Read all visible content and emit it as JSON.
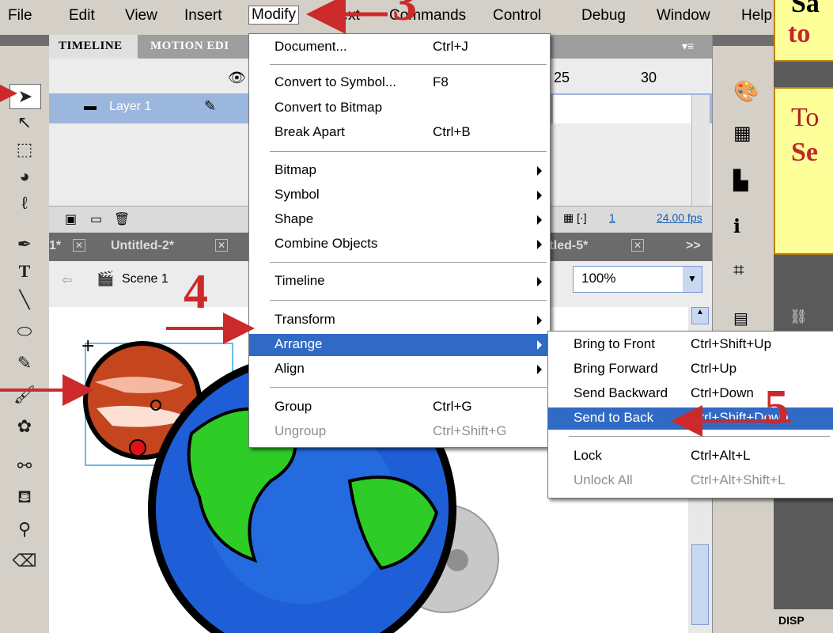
{
  "menubar": {
    "items": [
      "File",
      "Edit",
      "View",
      "Insert",
      "Modify",
      "Text",
      "Commands",
      "Control",
      "Debug",
      "Window",
      "Help"
    ]
  },
  "timeline": {
    "tab_timeline": "TIMELINE",
    "tab_motion": "MOTION EDI",
    "layer_name": "Layer 1",
    "frame_ticks": [
      "25",
      "30"
    ],
    "current_frame": "1",
    "fps": "24.00 fps"
  },
  "doctabs": {
    "tab1": "1* ",
    "tab2": "Untitled-2*",
    "tab5": "itled-5*",
    "more": ">>"
  },
  "scene": {
    "label": "Scene 1",
    "zoom": "100%"
  },
  "modify_menu": {
    "items": [
      {
        "label": "Document...",
        "shortcut": "Ctrl+J",
        "submenu": false,
        "disabled": false
      },
      {
        "label": "Convert to Symbol...",
        "shortcut": "F8",
        "submenu": false,
        "disabled": false
      },
      {
        "label": "Convert to Bitmap",
        "shortcut": "",
        "submenu": false,
        "disabled": false
      },
      {
        "label": "Break Apart",
        "shortcut": "Ctrl+B",
        "submenu": false,
        "disabled": false
      },
      {
        "label": "Bitmap",
        "shortcut": "",
        "submenu": true,
        "disabled": false
      },
      {
        "label": "Symbol",
        "shortcut": "",
        "submenu": true,
        "disabled": false
      },
      {
        "label": "Shape",
        "shortcut": "",
        "submenu": true,
        "disabled": false
      },
      {
        "label": "Combine Objects",
        "shortcut": "",
        "submenu": true,
        "disabled": false
      },
      {
        "label": "Timeline",
        "shortcut": "",
        "submenu": true,
        "disabled": false
      },
      {
        "label": "Transform",
        "shortcut": "",
        "submenu": true,
        "disabled": false
      },
      {
        "label": "Arrange",
        "shortcut": "",
        "submenu": true,
        "disabled": false
      },
      {
        "label": "Align",
        "shortcut": "",
        "submenu": true,
        "disabled": false
      },
      {
        "label": "Group",
        "shortcut": "Ctrl+G",
        "submenu": false,
        "disabled": false
      },
      {
        "label": "Ungroup",
        "shortcut": "Ctrl+Shift+G",
        "submenu": false,
        "disabled": true
      }
    ]
  },
  "arrange_menu": {
    "items": [
      {
        "label": "Bring to Front",
        "shortcut": "Ctrl+Shift+Up",
        "disabled": false
      },
      {
        "label": "Bring Forward",
        "shortcut": "Ctrl+Up",
        "disabled": false
      },
      {
        "label": "Send Backward",
        "shortcut": "Ctrl+Down",
        "disabled": false
      },
      {
        "label": "Send to Back",
        "shortcut": "Ctrl+Shift+Down",
        "disabled": false
      },
      {
        "label": "Lock",
        "shortcut": "Ctrl+Alt+L",
        "disabled": false
      },
      {
        "label": "Unlock All",
        "shortcut": "Ctrl+Alt+Shift+L",
        "disabled": true
      }
    ]
  },
  "annotations": {
    "step3": "3",
    "step4": "4",
    "step5": "5",
    "callout_top": "Sa",
    "callout_top_line2": "to",
    "callout_mid_1": "To",
    "callout_mid_2": "Se"
  },
  "right_panel": {
    "bottom_label": "DISP"
  },
  "colors": {
    "highlight": "#316ac5",
    "annotation_red": "#cc2a2a",
    "callout_bg": "#ffff99"
  }
}
